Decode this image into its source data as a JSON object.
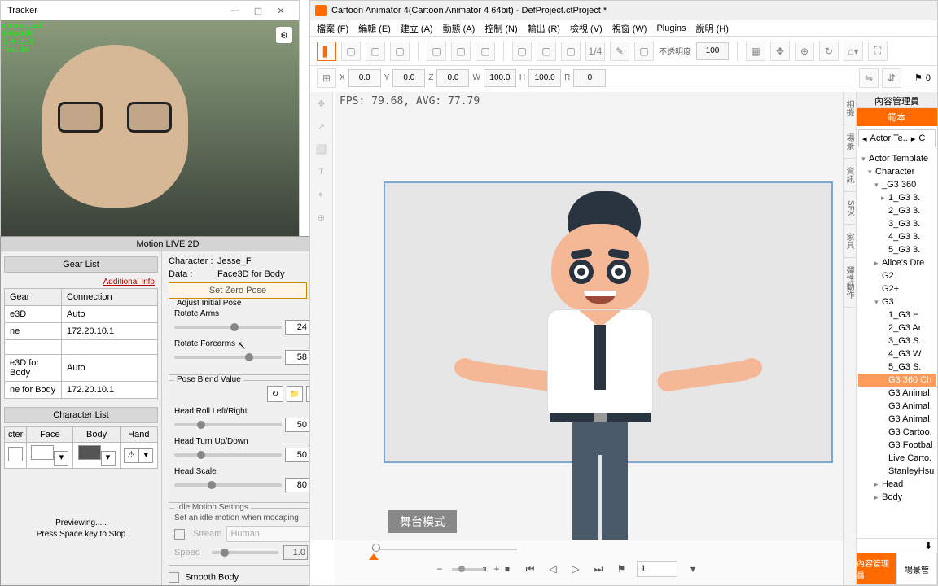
{
  "tracker": {
    "title": "Tracker",
    "overlay": "connected\n640x480\n1.0.1.1\nfps:30"
  },
  "ml2d": {
    "title": "Motion LIVE 2D",
    "gear_list": "Gear List",
    "additional_info": "Additional Info",
    "gear_head": "Gear",
    "conn_head": "Connection",
    "rows": [
      {
        "g": "e3D",
        "c": "Auto"
      },
      {
        "g": "ne",
        "c": "172.20.10.1"
      },
      {
        "g": "",
        "c": ""
      },
      {
        "g": "e3D for Body",
        "c": "Auto"
      },
      {
        "g": "ne for Body",
        "c": "172.20.10.1"
      }
    ],
    "char_list": "Character List",
    "cols": [
      "cter",
      "Face",
      "Body",
      "Hand"
    ],
    "preview": "Previewing.....\nPress Space key to Stop",
    "character_lbl": "Character :",
    "character": "Jesse_F",
    "data_lbl": "Data :",
    "data": "Face3D for Body",
    "set_zero": "Set Zero Pose",
    "adjust_pose": "Adjust Initial Pose",
    "rotate_arms": "Rotate Arms",
    "rotate_arms_val": "24",
    "rotate_fore": "Rotate Forearms",
    "rotate_fore_val": "58",
    "pose_blend": "Pose Blend Value",
    "head_roll": "Head Roll Left/Right",
    "head_roll_val": "50",
    "head_turn": "Head Turn Up/Down",
    "head_turn_val": "50",
    "head_scale": "Head Scale",
    "head_scale_val": "80",
    "idle_title": "Idle Motion Settings",
    "idle_desc": "Set an idle motion when mocaping",
    "idle_stream": "Stream",
    "idle_human": "Human",
    "idle_speed": "Speed",
    "idle_speed_val": "1.0",
    "smooth": "Smooth Body"
  },
  "ca": {
    "title": "Cartoon Animator 4(Cartoon Animator 4 64bit) - DefProject.ctProject *",
    "menu": [
      "檔案 (F)",
      "編輯 (E)",
      "建立 (A)",
      "動態 (A)",
      "控制 (N)",
      "輸出 (R)",
      "檢視 (V)",
      "視窗 (W)",
      "Plugins",
      "說明 (H)"
    ],
    "toolbar": {
      "opacity_label": "不透明度",
      "opacity": "100"
    },
    "coords": {
      "x": "X",
      "xv": "0.0",
      "y": "Y",
      "yv": "0.0",
      "z": "Z",
      "zv": "0.0",
      "w": "W",
      "wv": "100.0",
      "h": "H",
      "hv": "100.0",
      "r": "R",
      "rv": "0",
      "layer": "0"
    },
    "fps": "FPS: 79.68, AVG: 77.79",
    "mode": "舞台模式",
    "frame": "1",
    "vtabs": [
      "相機",
      "場景",
      "資訊",
      "SFX",
      "家具",
      "彈性動作"
    ],
    "cp_title": "內容管理員",
    "cp_tab": "範本",
    "crumb": [
      "Actor Te..",
      "C"
    ],
    "tree": [
      {
        "t": "Actor Template",
        "d": 0,
        "e": "▾"
      },
      {
        "t": "Character",
        "d": 1,
        "e": "▾"
      },
      {
        "t": "_G3 360",
        "d": 2,
        "e": "▾"
      },
      {
        "t": "1_G3 3.",
        "d": 3,
        "e": "▸"
      },
      {
        "t": "2_G3 3.",
        "d": 3
      },
      {
        "t": "3_G3 3.",
        "d": 3
      },
      {
        "t": "4_G3 3.",
        "d": 3
      },
      {
        "t": "5_G3 3.",
        "d": 3
      },
      {
        "t": "Alice's Dre",
        "d": 2,
        "e": "▸"
      },
      {
        "t": "G2",
        "d": 2
      },
      {
        "t": "G2+",
        "d": 2
      },
      {
        "t": "G3",
        "d": 2,
        "e": "▾"
      },
      {
        "t": "1_G3 H",
        "d": 3
      },
      {
        "t": "2_G3 Ar",
        "d": 3
      },
      {
        "t": "3_G3 S.",
        "d": 3
      },
      {
        "t": "4_G3 W",
        "d": 3
      },
      {
        "t": "5_G3 S.",
        "d": 3
      },
      {
        "t": "G3 360 Ch",
        "d": 3,
        "sel": true
      },
      {
        "t": "G3 Animal.",
        "d": 3
      },
      {
        "t": "G3 Animal.",
        "d": 3
      },
      {
        "t": "G3 Animal.",
        "d": 3
      },
      {
        "t": "G3 Cartoo.",
        "d": 3
      },
      {
        "t": "G3 Footbal",
        "d": 3
      },
      {
        "t": "Live Carto.",
        "d": 3
      },
      {
        "t": "StanleyHsu",
        "d": 3
      },
      {
        "t": "Head",
        "d": 2,
        "e": "▸"
      },
      {
        "t": "Body",
        "d": 2,
        "e": "▸"
      }
    ],
    "btabs": [
      "內容管理員",
      "場景管"
    ]
  }
}
